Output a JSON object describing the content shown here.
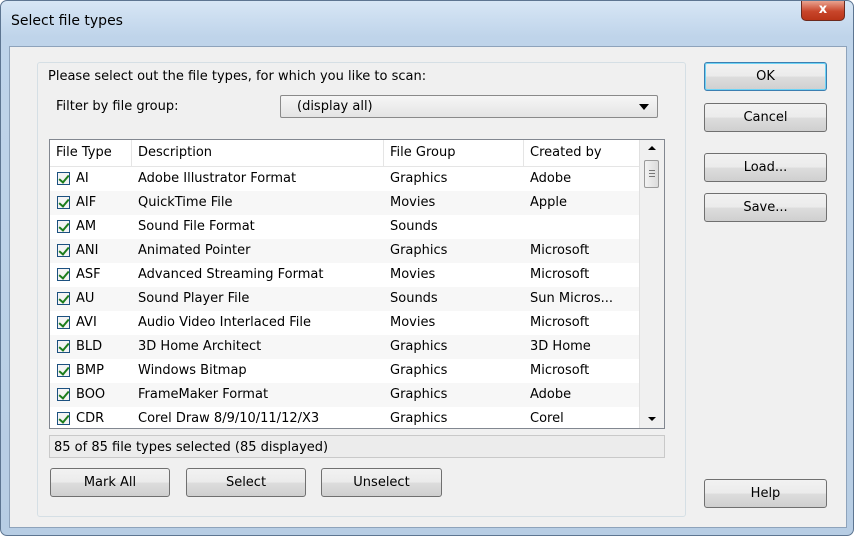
{
  "window": {
    "title": "Select file types",
    "close_glyph": "x"
  },
  "prompt": "Please select out the file types, for which you like to scan:",
  "filter": {
    "label": "Filter by file group:",
    "value": "(display all)"
  },
  "list": {
    "columns": [
      "File Type",
      "Description",
      "File Group",
      "Created by"
    ],
    "rows": [
      {
        "type": "AI",
        "description": "Adobe Illustrator Format",
        "group": "Graphics",
        "creator": "Adobe",
        "checked": true
      },
      {
        "type": "AIF",
        "description": "QuickTime File",
        "group": "Movies",
        "creator": "Apple",
        "checked": true
      },
      {
        "type": "AM",
        "description": "Sound File Format",
        "group": "Sounds",
        "creator": "",
        "checked": true
      },
      {
        "type": "ANI",
        "description": "Animated Pointer",
        "group": "Graphics",
        "creator": "Microsoft",
        "checked": true
      },
      {
        "type": "ASF",
        "description": "Advanced Streaming Format",
        "group": "Movies",
        "creator": "Microsoft",
        "checked": true
      },
      {
        "type": "AU",
        "description": "Sound Player File",
        "group": "Sounds",
        "creator": "Sun Micros...",
        "checked": true
      },
      {
        "type": "AVI",
        "description": "Audio Video Interlaced File",
        "group": "Movies",
        "creator": "Microsoft",
        "checked": true
      },
      {
        "type": "BLD",
        "description": "3D Home Architect",
        "group": "Graphics",
        "creator": "3D Home",
        "checked": true
      },
      {
        "type": "BMP",
        "description": "Windows Bitmap",
        "group": "Graphics",
        "creator": "Microsoft",
        "checked": true
      },
      {
        "type": "BOO",
        "description": "FrameMaker Format",
        "group": "Graphics",
        "creator": "Adobe",
        "checked": true
      },
      {
        "type": "CDR",
        "description": "Corel Draw 8/9/10/11/12/X3",
        "group": "Graphics",
        "creator": "Corel",
        "checked": true
      }
    ]
  },
  "status": "85 of 85 file types selected (85 displayed)",
  "buttons": {
    "ok": "OK",
    "cancel": "Cancel",
    "load": "Load...",
    "save": "Save...",
    "help": "Help",
    "mark_all": "Mark All",
    "select": "Select",
    "unselect": "Unselect"
  }
}
